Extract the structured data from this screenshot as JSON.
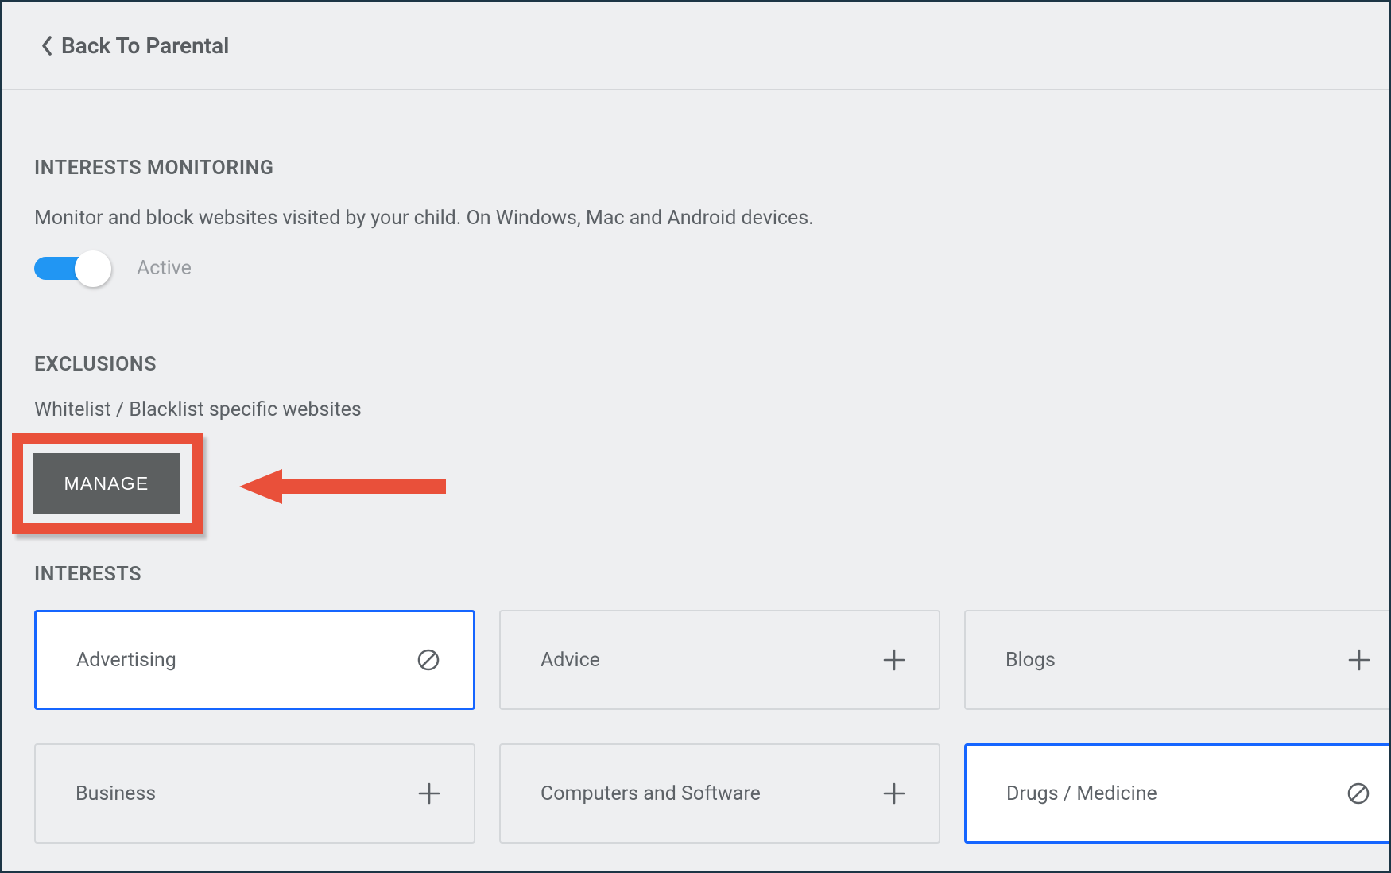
{
  "header": {
    "back_label": "Back To Parental"
  },
  "monitoring": {
    "title": "INTERESTS MONITORING",
    "desc": "Monitor and block websites visited by your child. On Windows, Mac and Android devices.",
    "toggle_label": "Active"
  },
  "exclusions": {
    "title": "EXCLUSIONS",
    "desc": "Whitelist / Blacklist specific websites",
    "button_label": "MANAGE"
  },
  "interests": {
    "title": "INTERESTS",
    "tiles": [
      {
        "label": "Advertising",
        "state": "blocked"
      },
      {
        "label": "Advice",
        "state": "add"
      },
      {
        "label": "Blogs",
        "state": "add"
      },
      {
        "label": "Business",
        "state": "add"
      },
      {
        "label": "Computers and Software",
        "state": "add"
      },
      {
        "label": "Drugs / Medicine",
        "state": "blocked"
      }
    ]
  },
  "colors": {
    "accent": "#2196f3",
    "highlight": "#e9503a",
    "selected_border": "#1565ff"
  }
}
